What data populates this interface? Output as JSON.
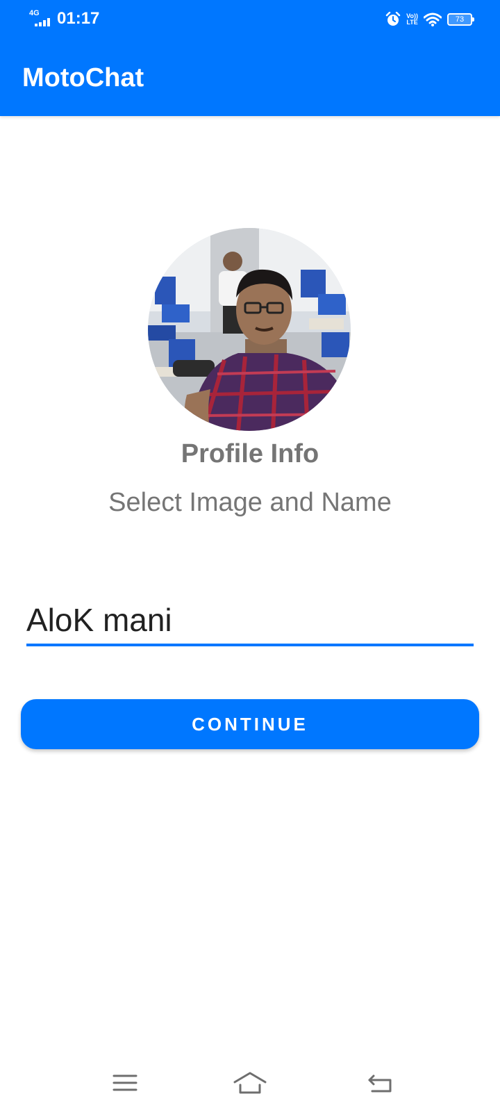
{
  "status_bar": {
    "network": "4G",
    "time": "01:17",
    "volte_top": "Vo))",
    "volte_bottom": "LTE",
    "battery": "73"
  },
  "app_bar": {
    "title": "MotoChat"
  },
  "profile": {
    "title": "Profile Info",
    "subtitle": "Select Image and Name"
  },
  "name_field": {
    "value": "AloK mani"
  },
  "continue_button": {
    "label": "CONTINUE"
  },
  "colors": {
    "primary": "#0077ff",
    "secondary_text": "#757575",
    "input_text": "#212121",
    "nav_icon": "#6e6e6e"
  },
  "icons": {
    "signal": "cell-signal-icon",
    "alarm": "alarm-icon",
    "wifi": "wifi-icon",
    "battery": "battery-icon",
    "menu": "menu-icon",
    "home": "home-icon",
    "back": "back-icon"
  }
}
